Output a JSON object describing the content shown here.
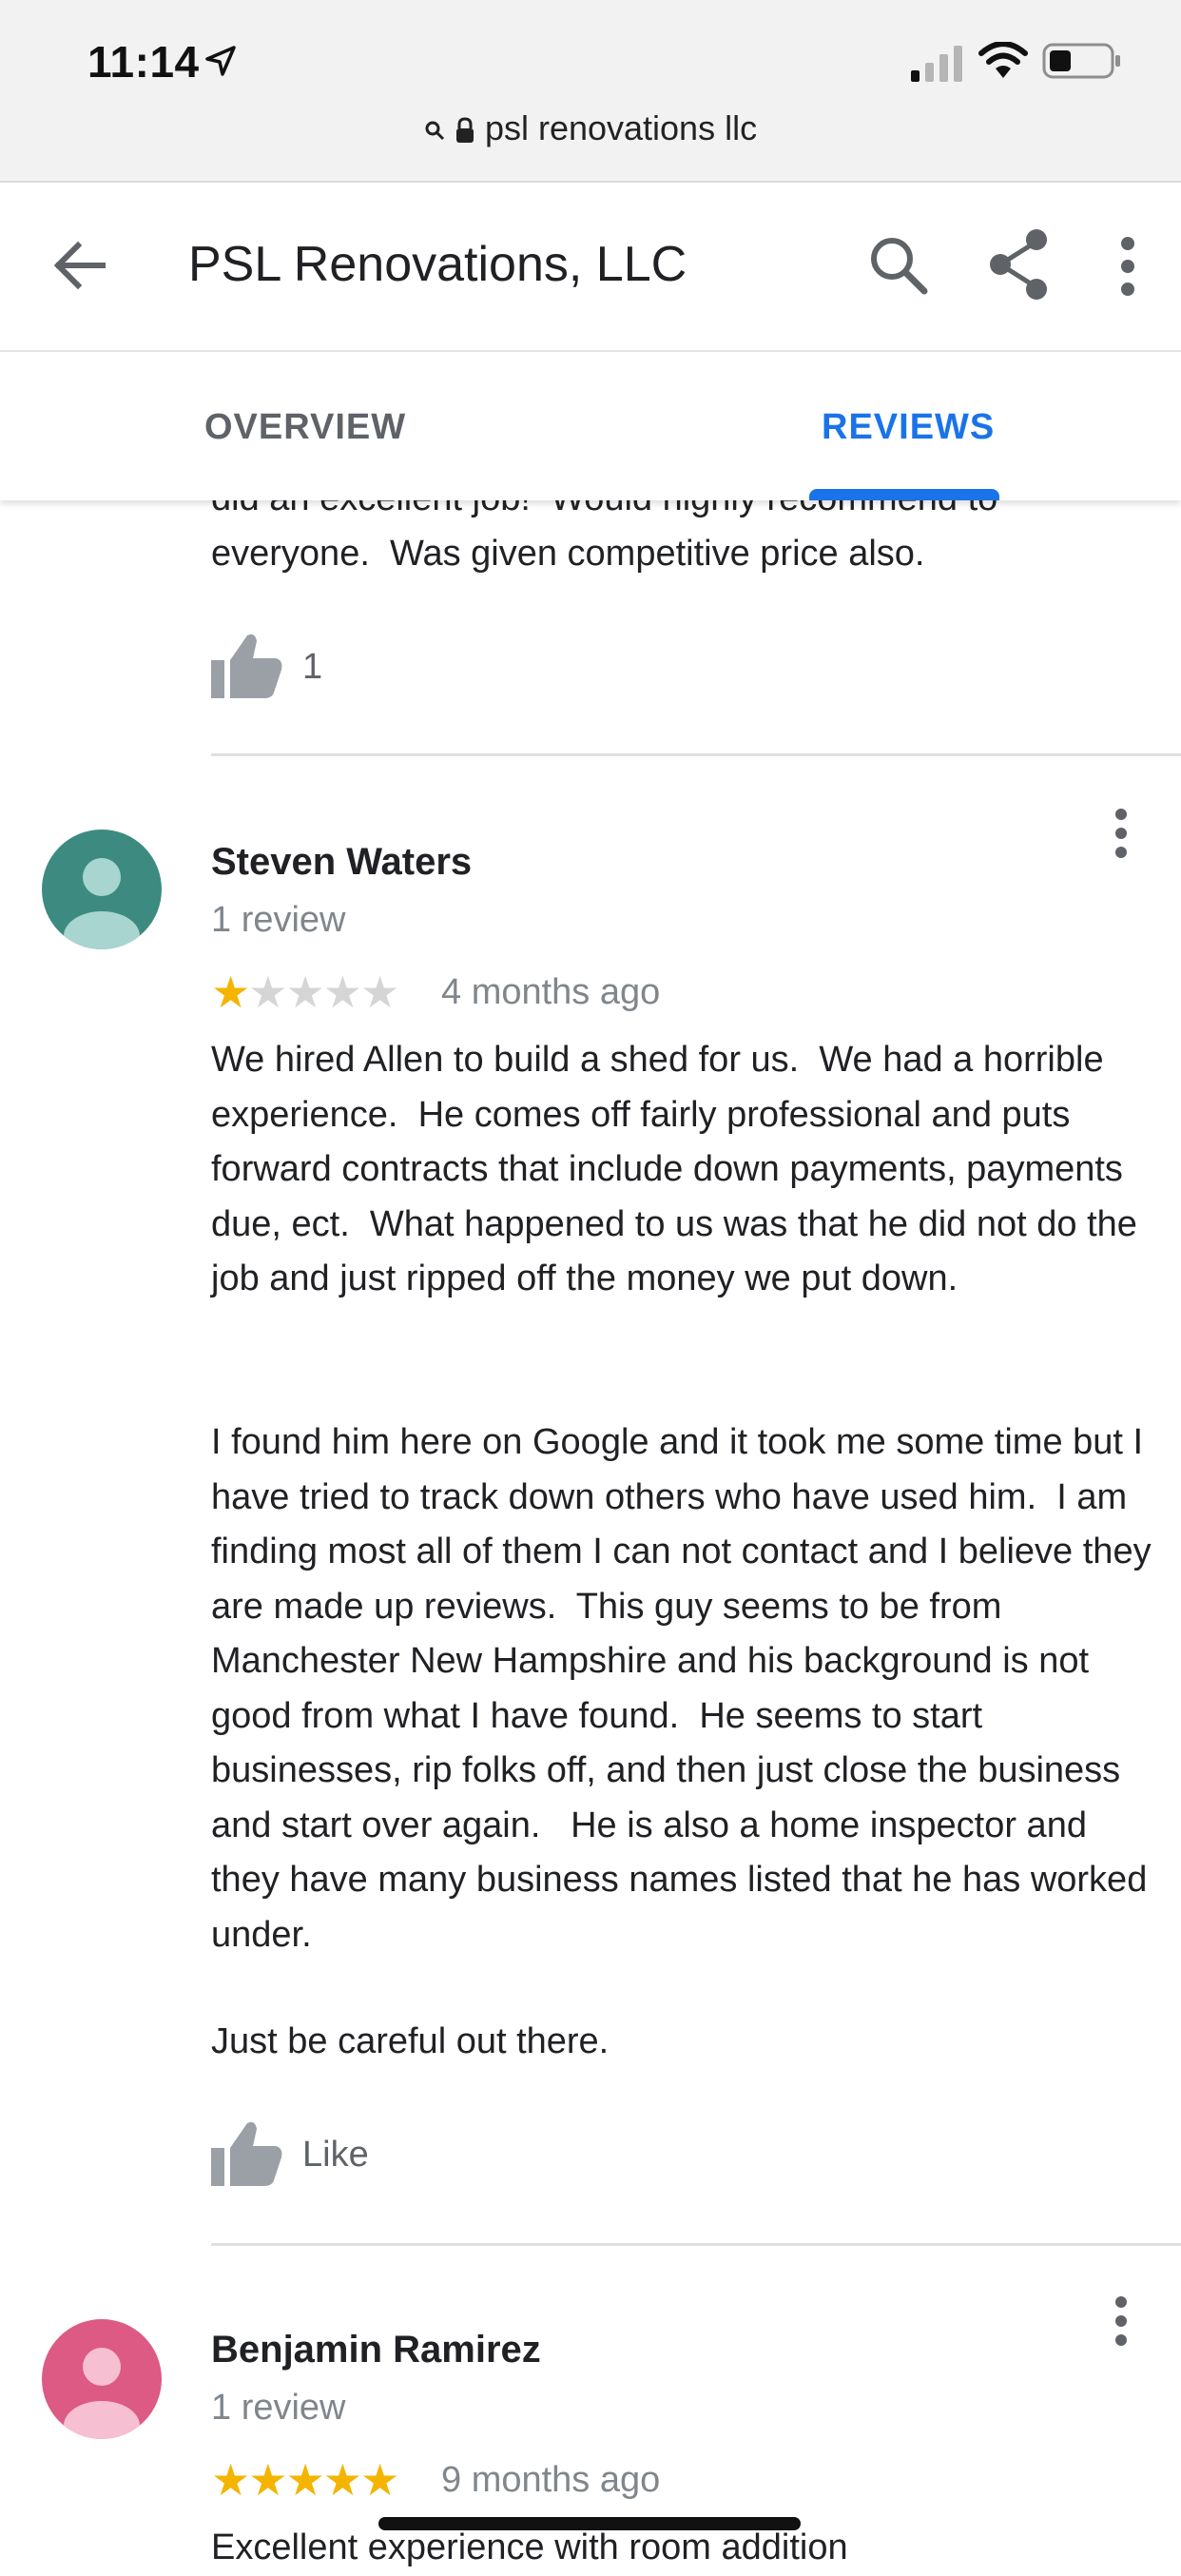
{
  "status_bar": {
    "time": "11:14",
    "url": "psl renovations llc"
  },
  "app_bar": {
    "title": "PSL Renovations, LLC"
  },
  "tabs": [
    {
      "label": "OVERVIEW",
      "active": false
    },
    {
      "label": "REVIEWS",
      "active": true
    }
  ],
  "colors": {
    "accent": "#1a73e8",
    "star": "#f4b400",
    "avatar_teal": "#3d8b80",
    "avatar_pink": "#dd5a85"
  },
  "prev_review": {
    "text_cut": "did an excellent job!  Would highly recommend to",
    "text_tail": "everyone.  Was given competitive price also.",
    "likes": "1"
  },
  "reviews": [
    {
      "name": "Steven Waters",
      "count": "1 review",
      "rating": 1,
      "stars_on": "★",
      "stars_off": "★★★★",
      "date": "4 months ago",
      "paragraphs": [
        "We hired Allen to build a shed for us.  We had a horrible experience.  He comes off fairly professional and puts forward contracts that include down payments, payments due, ect.  What happened to us was that he did not do the job and just ripped off the money we put down.",
        "I found him here on Google and it took me some time but I have tried to track down others who have used him.  I am finding most all of them I can not contact and I believe they are made up reviews.  This guy seems to be from Manchester New Hampshire and his background is not good from what I have found.  He seems to start businesses, rip folks off, and then just close the business and start over again.   He is also a home inspector and they have many business names listed that he has worked under.",
        "Just be careful out there."
      ],
      "like_label": "Like"
    },
    {
      "name": "Benjamin Ramirez",
      "count": "1 review",
      "rating": 5,
      "stars_on": "★★★★★",
      "stars_off": "",
      "date": "9 months ago",
      "text_cut": "Excellent experience with room addition"
    }
  ]
}
